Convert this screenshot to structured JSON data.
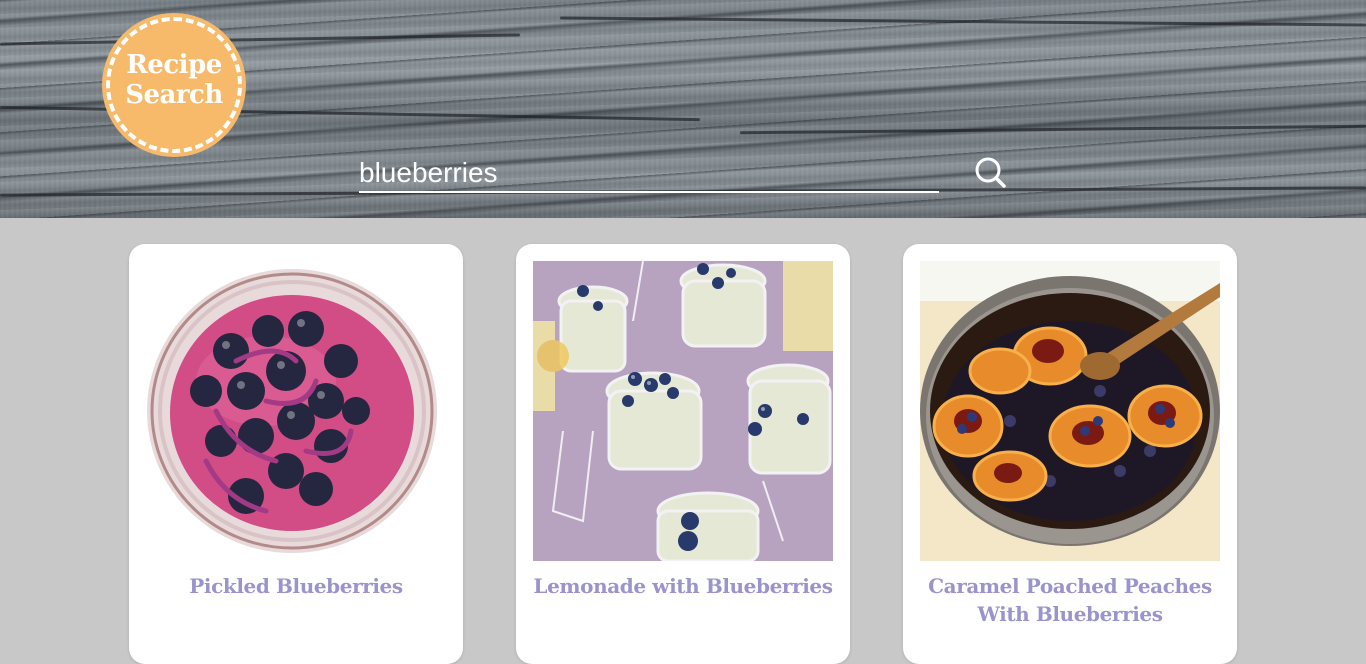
{
  "logo": {
    "line1": "Recipe",
    "line2": "Search"
  },
  "search": {
    "value": "blueberries",
    "placeholder": ""
  },
  "results": [
    {
      "title": "Pickled Blueberries"
    },
    {
      "title": "Lemonade with Blueberries"
    },
    {
      "title": "Caramel Poached Peaches With Blueberries"
    }
  ],
  "colors": {
    "logo_bg": "#f7ba6a",
    "title_text": "#9a93cc",
    "page_bg": "#c8c8c8"
  }
}
